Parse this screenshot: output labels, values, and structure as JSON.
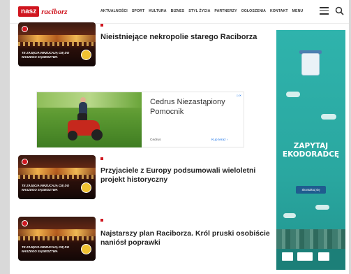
{
  "header": {
    "logo_box": "nasz",
    "logo_text": "raciborz",
    "nav": [
      "AKTUALNOŚCI",
      "SPORT",
      "KULTURA",
      "BIZNES",
      "STYL ŻYCIA",
      "PARTNERZY",
      "OGŁOSZENIA",
      "KONTAKT",
      "MENU"
    ],
    "menu_icon": "hamburger-icon",
    "search_icon": "search-icon"
  },
  "articles": [
    {
      "title": "Nieistniejące nekropolie starego Raciborza",
      "thumb_text": "Te zajęcia wrzucają Cię do Naszego Sąsiedztwa"
    },
    {
      "title": "Przyjaciele z Europy podsumowali wieloletni projekt historyczny",
      "thumb_text": "Te zajęcia wrzucają Cię do Naszego Sąsiedztwa"
    },
    {
      "title": "Najstarszy plan Raciborza. Król pruski osobiście naniósł poprawki",
      "thumb_text": "Te zajęcia wrzucają Cię do Naszego Sąsiedztwa"
    }
  ],
  "ad": {
    "title": "Cedrus Niezastąpiony Pomocnik",
    "brand": "Cedrus",
    "link": "Kup teraz"
  },
  "banner": {
    "title_line1": "ZAPYTAJ",
    "title_line2": "EKODORADCĘ",
    "button": "Skontaktuj się"
  },
  "colors": {
    "brand_red": "#d0161f",
    "banner_teal": "#2fb3ac"
  }
}
